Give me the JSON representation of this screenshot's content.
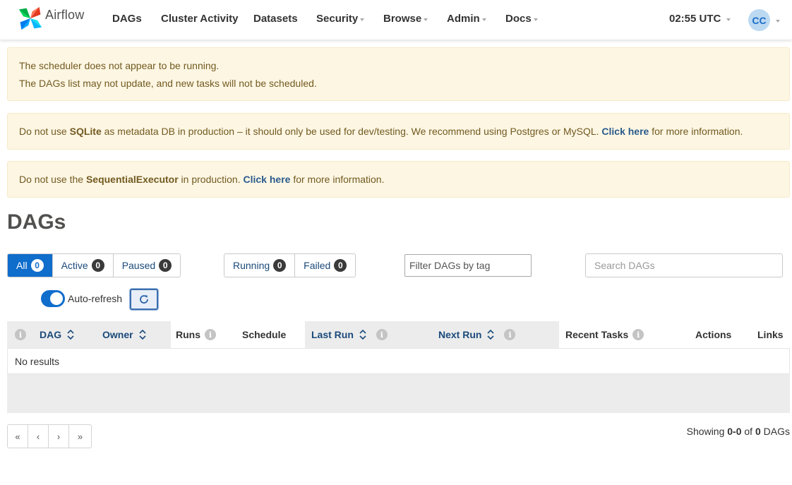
{
  "navbar": {
    "brand": "Airflow",
    "items": [
      {
        "label": "DAGs",
        "dropdown": false
      },
      {
        "label": "Cluster Activity",
        "dropdown": false
      },
      {
        "label": "Datasets",
        "dropdown": false
      },
      {
        "label": "Security",
        "dropdown": true
      },
      {
        "label": "Browse",
        "dropdown": true
      },
      {
        "label": "Admin",
        "dropdown": true
      },
      {
        "label": "Docs",
        "dropdown": true
      }
    ],
    "clock": "02:55 UTC",
    "avatar_initials": "CC"
  },
  "alerts": {
    "scheduler_line1": "The scheduler does not appear to be running.",
    "scheduler_line2": "The DAGs list may not update, and new tasks will not be scheduled.",
    "sqlite_prefix": "Do not use ",
    "sqlite_bold": "SQLite",
    "sqlite_middle": " as metadata DB in production – it should only be used for dev/testing. We recommend using Postgres or MySQL. ",
    "sqlite_link": "Click here",
    "sqlite_suffix": " for more information.",
    "executor_prefix": "Do not use the ",
    "executor_bold": "SequentialExecutor",
    "executor_middle": " in production. ",
    "executor_link": "Click here",
    "executor_suffix": " for more information."
  },
  "page_title": "DAGs",
  "filters": {
    "status": [
      {
        "label": "All",
        "count": "0",
        "active": true
      },
      {
        "label": "Active",
        "count": "0",
        "active": false
      },
      {
        "label": "Paused",
        "count": "0",
        "active": false
      }
    ],
    "run_state": [
      {
        "label": "Running",
        "count": "0"
      },
      {
        "label": "Failed",
        "count": "0"
      }
    ],
    "tag_placeholder": "Filter DAGs by tag",
    "search_placeholder": "Search DAGs"
  },
  "auto_refresh": {
    "label": "Auto-refresh",
    "enabled": true
  },
  "table": {
    "columns": {
      "dag": "DAG",
      "owner": "Owner",
      "runs": "Runs",
      "schedule": "Schedule",
      "last_run": "Last Run",
      "next_run": "Next Run",
      "recent_tasks": "Recent Tasks",
      "actions": "Actions",
      "links": "Links"
    },
    "empty_text": "No results"
  },
  "pagination": {
    "first": "«",
    "prev": "‹",
    "next": "›",
    "last": "»"
  },
  "showing": {
    "prefix": "Showing ",
    "range": "0-0",
    "of": " of ",
    "total": "0",
    "suffix": " DAGs"
  },
  "colors": {
    "primary": "#0f6dcc",
    "alert_bg": "#fdf6e3",
    "alert_text": "#725a20",
    "link": "#1a4a7a"
  }
}
